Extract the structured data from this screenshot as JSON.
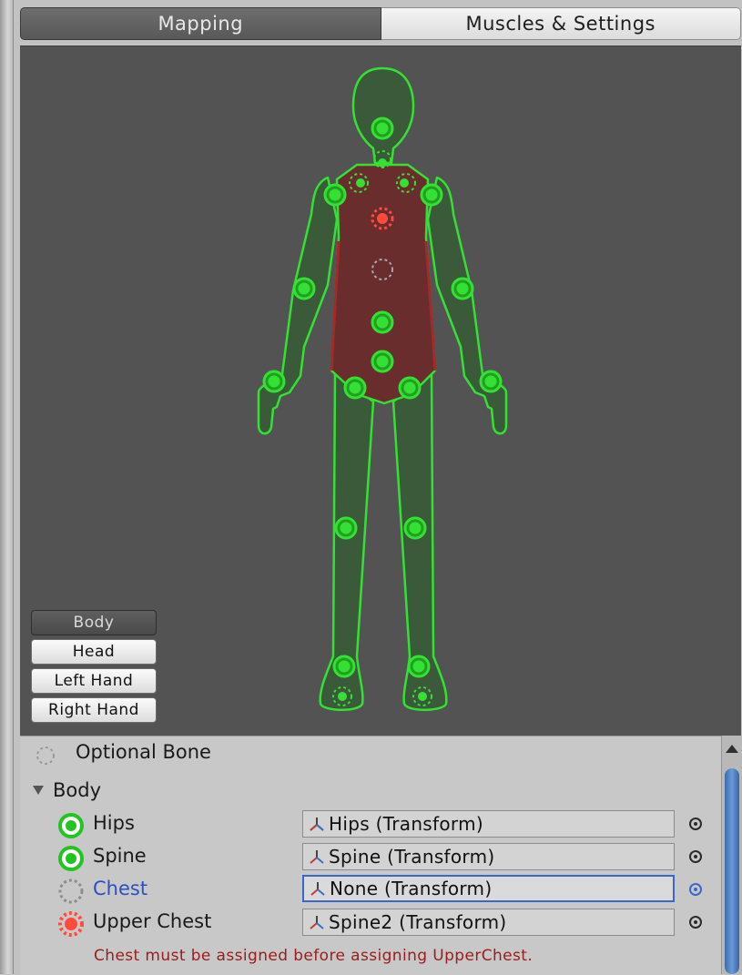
{
  "tabs": [
    {
      "label": "Mapping",
      "active": true
    },
    {
      "label": "Muscles & Settings",
      "active": false
    }
  ],
  "body_parts": [
    {
      "label": "Body",
      "active": true
    },
    {
      "label": "Head",
      "active": false
    },
    {
      "label": "Left Hand",
      "active": false
    },
    {
      "label": "Right Hand",
      "active": false
    }
  ],
  "legend": {
    "optional_label": "Optional Bone"
  },
  "section": {
    "label": "Body",
    "expanded": true
  },
  "bones": [
    {
      "label": "Hips",
      "value": "Hips (Transform)",
      "state": "assigned",
      "selected": false
    },
    {
      "label": "Spine",
      "value": "Spine (Transform)",
      "state": "assigned",
      "selected": false
    },
    {
      "label": "Chest",
      "value": "None (Transform)",
      "state": "optional",
      "selected": true
    },
    {
      "label": "Upper Chest",
      "value": "Spine2 (Transform)",
      "state": "error",
      "selected": false
    }
  ],
  "warning": "Chest must be assigned before assigning UpperChest.",
  "colors": {
    "valid_green": "#22c422",
    "error_red": "#ff4a3d",
    "selection_blue": "#3b66c9",
    "warning_text": "#9b1c1c"
  }
}
